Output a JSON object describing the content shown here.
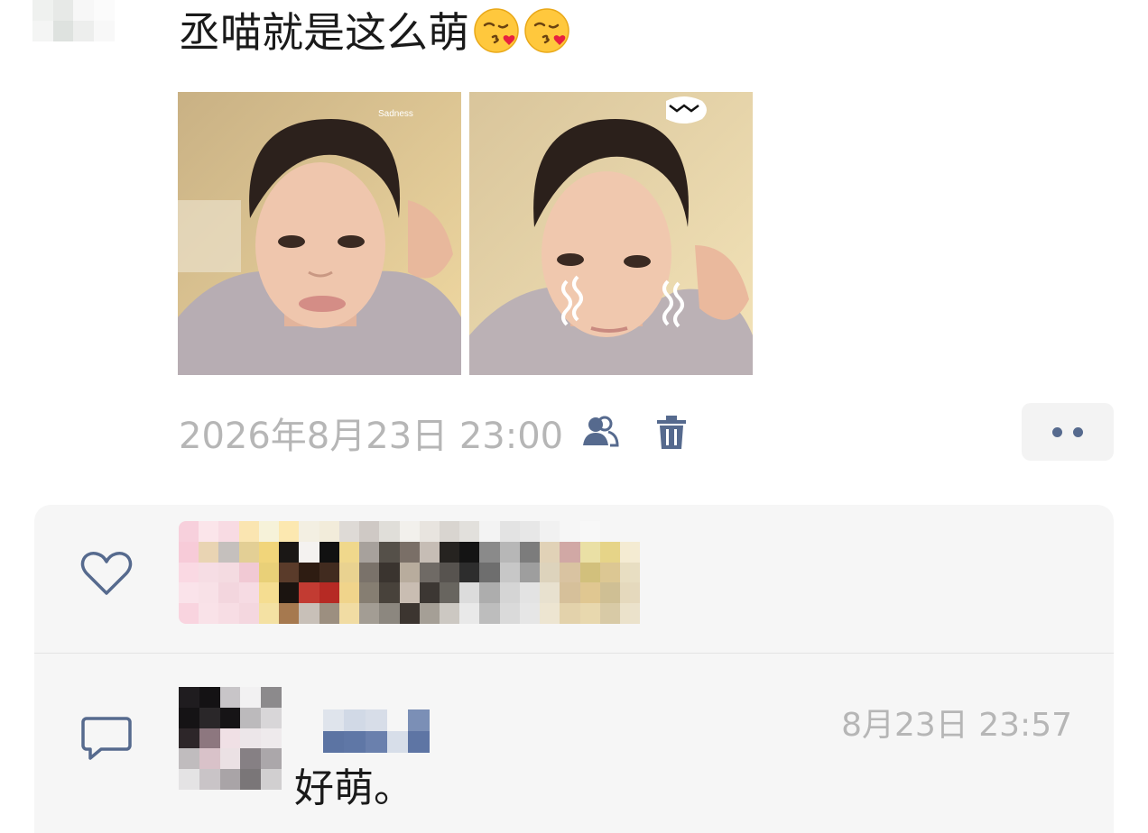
{
  "post": {
    "text": "丞喵就是这么萌",
    "emojis": [
      "face-blowing-kiss-icon",
      "face-blowing-kiss-icon"
    ],
    "photos": [
      {
        "name": "selfie-photo-1",
        "sticker_text": "Sadness"
      },
      {
        "name": "selfie-photo-2"
      }
    ],
    "timestamp": "2026年8月23日 23:00",
    "visibility_icon": "two-people-icon",
    "delete_icon": "trash-icon",
    "more_icon": "two-dots-icon"
  },
  "likes": {
    "icon": "heart-outline-icon"
  },
  "comments": [
    {
      "icon": "comment-bubble-icon",
      "time": "8月23日 23:57",
      "text": "好萌。"
    }
  ],
  "colors": {
    "accent": "#566a8e",
    "timestamp": "#b6b6b6",
    "panel": "#f6f6f6",
    "text": "#1a1a1a"
  }
}
